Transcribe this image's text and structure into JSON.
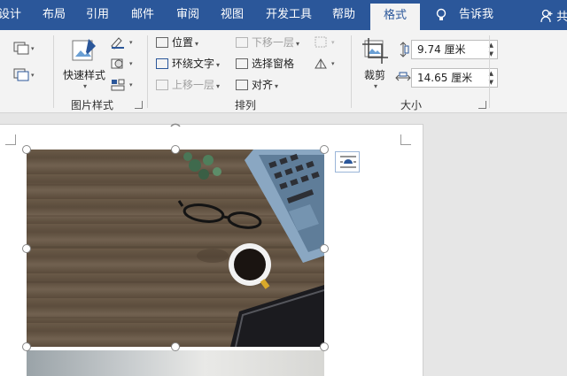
{
  "tabs": [
    {
      "label": "设计"
    },
    {
      "label": "布局"
    },
    {
      "label": "引用"
    },
    {
      "label": "邮件"
    },
    {
      "label": "审阅"
    },
    {
      "label": "视图"
    },
    {
      "label": "开发工具"
    },
    {
      "label": "帮助"
    },
    {
      "label": "格式",
      "active": true
    }
  ],
  "tell_me": "告诉我",
  "share_label": "共",
  "groups": {
    "picture_styles": {
      "label": "图片样式",
      "quick_styles": "快速样式"
    },
    "arrange": {
      "label": "排列",
      "position": "位置",
      "wrap_text": "环绕文字",
      "bring_forward": "上移一层",
      "send_backward": "下移一层",
      "selection_pane": "选择窗格",
      "align": "对齐"
    },
    "size": {
      "label": "大小",
      "crop": "裁剪",
      "height": "9.74 厘米",
      "width": "14.65 厘米"
    }
  },
  "colors": {
    "accent": "#2b579a"
  }
}
